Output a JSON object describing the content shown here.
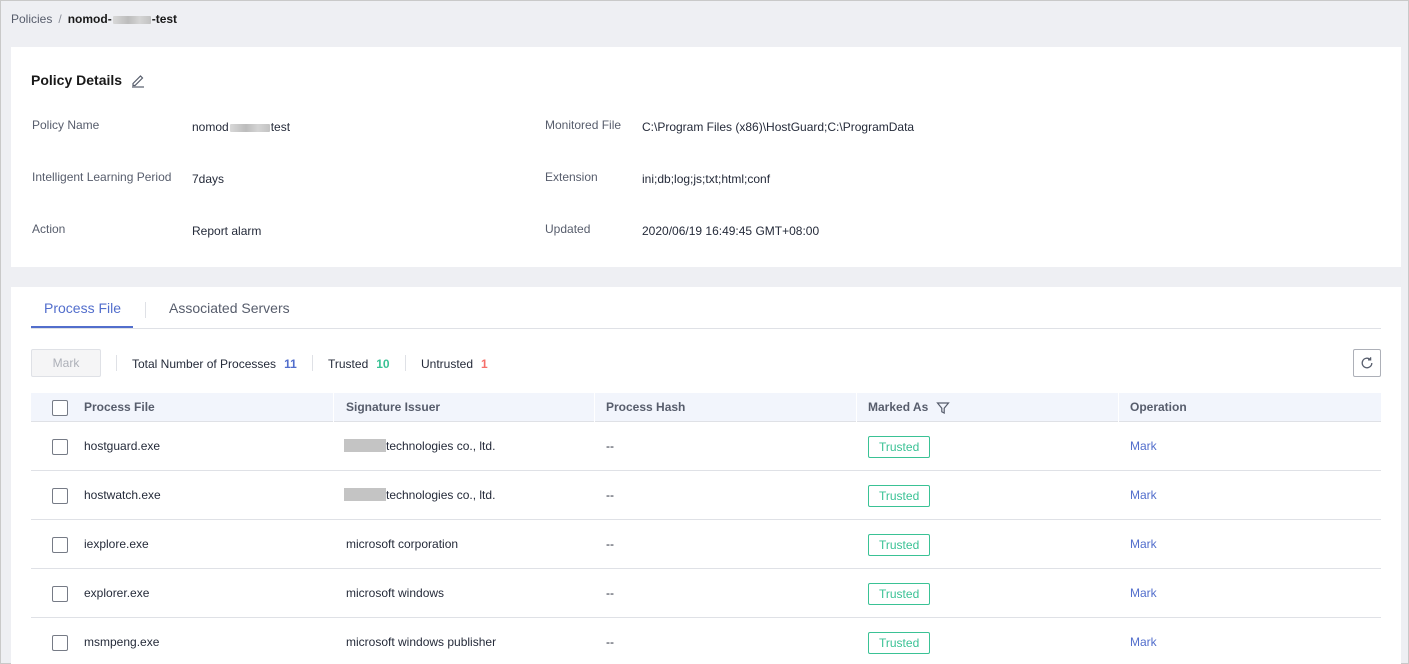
{
  "breadcrumb": {
    "parent": "Policies",
    "separator": "/",
    "current_prefix": "nomod-",
    "current_suffix": "-test"
  },
  "details": {
    "title": "Policy Details",
    "fields": {
      "policy_name": {
        "label": "Policy Name",
        "value_prefix": "nomod",
        "value_suffix": "test"
      },
      "learning_period": {
        "label": "Intelligent Learning Period",
        "value": "7days"
      },
      "action": {
        "label": "Action",
        "value": "Report alarm"
      },
      "monitored_file": {
        "label": "Monitored File",
        "value": "C:\\Program Files (x86)\\HostGuard;C:\\ProgramData"
      },
      "extension": {
        "label": "Extension",
        "value": "ini;db;log;js;txt;html;conf"
      },
      "updated": {
        "label": "Updated",
        "value": "2020/06/19 16:49:45 GMT+08:00"
      }
    }
  },
  "tabs": [
    {
      "label": "Process File",
      "active": true
    },
    {
      "label": "Associated Servers",
      "active": false
    }
  ],
  "toolbar": {
    "mark_label": "Mark",
    "stats": [
      {
        "label": "Total Number of Processes",
        "value": "11",
        "color": "#526ecc"
      },
      {
        "label": "Trusted",
        "value": "10",
        "color": "#3ac295"
      },
      {
        "label": "Untrusted",
        "value": "1",
        "color": "#f66f6a"
      }
    ]
  },
  "table": {
    "columns": [
      "Process File",
      "Signature Issuer",
      "Process Hash",
      "Marked As",
      "Operation"
    ],
    "rows": [
      {
        "file": "hostguard.exe",
        "issuer": "technologies co., ltd.",
        "issuer_redacted": true,
        "hash": "--",
        "marked": "Trusted",
        "op": "Mark"
      },
      {
        "file": "hostwatch.exe",
        "issuer": "technologies co., ltd.",
        "issuer_redacted": true,
        "hash": "--",
        "marked": "Trusted",
        "op": "Mark"
      },
      {
        "file": "iexplore.exe",
        "issuer": "microsoft corporation",
        "issuer_redacted": false,
        "hash": "--",
        "marked": "Trusted",
        "op": "Mark"
      },
      {
        "file": "explorer.exe",
        "issuer": "microsoft windows",
        "issuer_redacted": false,
        "hash": "--",
        "marked": "Trusted",
        "op": "Mark"
      },
      {
        "file": "msmpeng.exe",
        "issuer": "microsoft windows publisher",
        "issuer_redacted": false,
        "hash": "--",
        "marked": "Trusted",
        "op": "Mark"
      }
    ]
  },
  "colors": {
    "accent": "#526ecc",
    "trusted": "#3ac295",
    "untrusted": "#f66f6a",
    "page_bg": "#eeeff3"
  },
  "icons": {
    "edit": "edit-icon",
    "refresh": "refresh-icon",
    "filter": "filter-icon"
  }
}
